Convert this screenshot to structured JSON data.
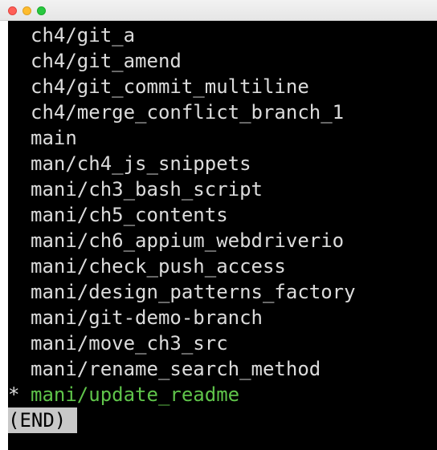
{
  "terminal": {
    "branches": [
      {
        "marker": "",
        "name": "ch4/git_a"
      },
      {
        "marker": "",
        "name": "ch4/git_amend"
      },
      {
        "marker": "",
        "name": "ch4/git_commit_multiline"
      },
      {
        "marker": "",
        "name": "ch4/merge_conflict_branch_1"
      },
      {
        "marker": "",
        "name": "main"
      },
      {
        "marker": "",
        "name": "man/ch4_js_snippets"
      },
      {
        "marker": "",
        "name": "mani/ch3_bash_script"
      },
      {
        "marker": "",
        "name": "mani/ch5_contents"
      },
      {
        "marker": "",
        "name": "mani/ch6_appium_webdriverio"
      },
      {
        "marker": "",
        "name": "mani/check_push_access"
      },
      {
        "marker": "",
        "name": "mani/design_patterns_factory"
      },
      {
        "marker": "",
        "name": "mani/git-demo-branch"
      },
      {
        "marker": "",
        "name": "mani/move_ch3_src"
      },
      {
        "marker": "",
        "name": "mani/rename_search_method"
      },
      {
        "marker": "*",
        "name": "mani/update_readme",
        "current": true
      }
    ],
    "pager_end": "(END)",
    "current_branch_color": "#5fc44a"
  }
}
